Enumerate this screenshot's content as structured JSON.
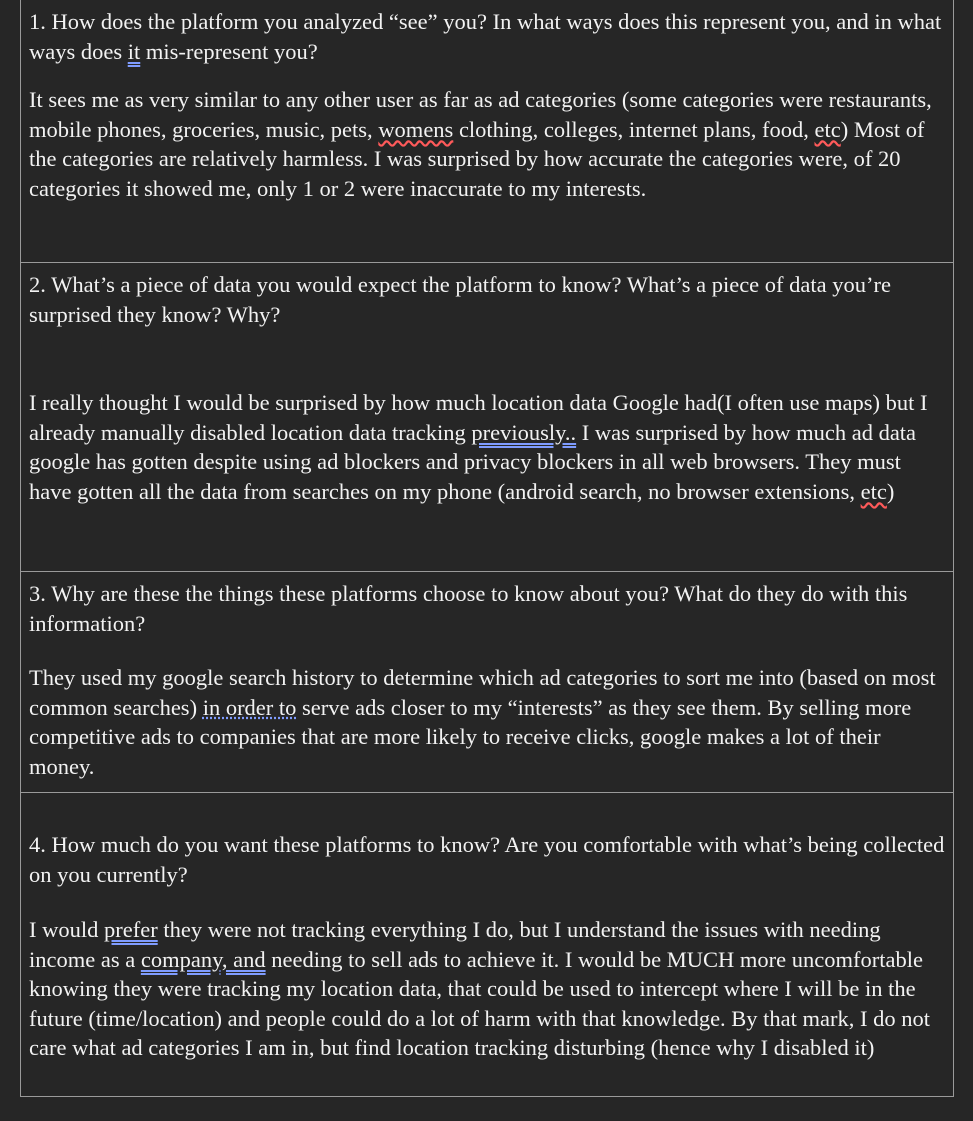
{
  "sections": [
    {
      "question": "1. How does the platform you analyzed “see” you? In what ways does this represent you, and in what ways does it mis-represent you?",
      "answer_parts": [
        "It sees me as very similar to any other user as far as ad categories (some categories were restaurants, mobile phones, groceries, music, pets, ",
        "womens",
        " clothing, colleges, internet plans, food, ",
        "etc",
        ") Most of the categories are relatively harmless. I was surprised by how accurate the categories were, of 20 categories it showed me, only 1 or 2 were inaccurate to my interests."
      ]
    },
    {
      "question": "2. What’s a piece of data you would expect the platform to know? What’s a piece of data you’re surprised they know? Why?",
      "answer_parts": [
        "I really thought I would be surprised by how much location data Google had(I often use maps) but I already manually disabled location data tracking ",
        "previously..",
        " I was surprised by how much ad data google has gotten despite using ad blockers and privacy blockers in all web browsers. They must have gotten all the data from searches on my phone (android search, no browser extensions, ",
        "etc",
        ")"
      ]
    },
    {
      "question": "3. Why are these the things these platforms choose to know about you? What do they do with this information?",
      "answer_parts": [
        "They used my google search history to determine which ad categories to sort me into (based on most common searches) ",
        "in order to",
        " serve ads closer to my “interests” as they see them. By selling more competitive ads to companies that are more likely to receive clicks, google makes a lot of their money."
      ]
    },
    {
      "question": "4. How much do you want these platforms to know? Are you comfortable with what’s being collected on you currently?",
      "answer_parts": [
        "I would ",
        "prefer",
        " they were not tracking everything I do, but I understand the issues with needing income as a ",
        "company, and",
        " needing to sell ads to achieve it. I would be MUCH more uncomfortable knowing they were tracking my location data, that could be used to intercept where I will be in the future (time/location) and people could do a lot of harm with that knowledge. By that mark, I do not care what ad categories I am in, but find location tracking disturbing (hence why I disabled it)"
      ]
    }
  ],
  "q1_it_word": "it",
  "colors": {
    "background": "#262626",
    "text": "#f2f2f2",
    "border": "#9a9a9a",
    "grammar_underline": "#7f9cff",
    "spelling_underline": "#ff5a5a"
  }
}
